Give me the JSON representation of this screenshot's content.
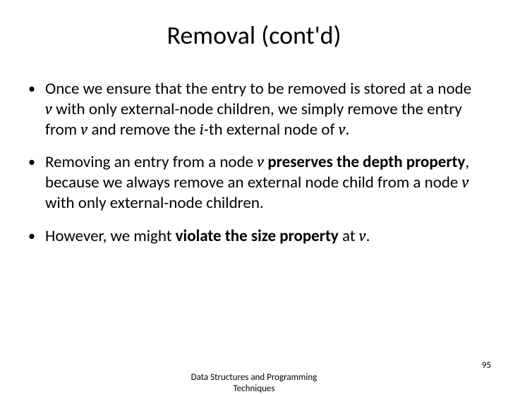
{
  "title": "Removal (cont'd)",
  "bullets": {
    "b1": {
      "pre": "Once we ensure that the entry to be removed is stored at a node ",
      "v1": "v",
      "mid1": " with only external-node children, we simply remove the entry from ",
      "v2": "v",
      "mid2": " and remove the ",
      "i": "i",
      "mid3": "-th external node of ",
      "v3": "v",
      "post": "."
    },
    "b2": {
      "pre": "Removing an entry from a node ",
      "v1": "v",
      "bold": " preserves the depth property",
      "mid1": ", because we always remove an external node child from a node ",
      "v2": "v",
      "post": " with only external-node children."
    },
    "b3": {
      "pre": "However, we might ",
      "bold": "violate the size property",
      "mid": " at ",
      "v": "v",
      "post": "."
    }
  },
  "footer": {
    "line1": "Data Structures and Programming",
    "line2": "Techniques"
  },
  "page": "95"
}
